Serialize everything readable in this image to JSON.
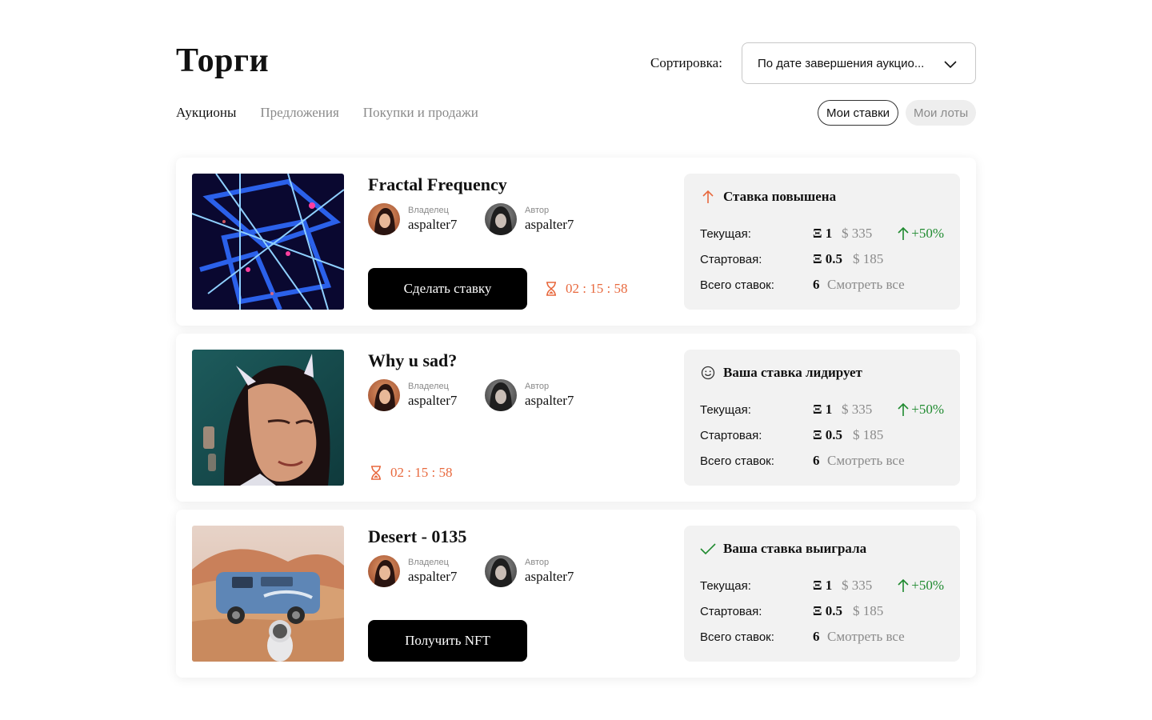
{
  "page": {
    "title": "Торги"
  },
  "sort": {
    "label": "Сортировка:",
    "value": "По дате завершения аукцио..."
  },
  "tabs": [
    {
      "label": "Аукционы",
      "active": true
    },
    {
      "label": "Предложения",
      "active": false
    },
    {
      "label": "Покупки и продажи",
      "active": false
    }
  ],
  "toggles": {
    "my_bids": "Мои ставки",
    "my_lots": "Мои лоты"
  },
  "colors": {
    "accent_orange": "#e8693e",
    "positive_green": "#1f8a2f",
    "muted": "#8a8a8a"
  },
  "common": {
    "owner_role": "Владелец",
    "author_role": "Автор",
    "current_label": "Текущая:",
    "start_label": "Стартовая:",
    "total_label": "Всего ставок:",
    "view_all": "Смотреть все"
  },
  "auctions": [
    {
      "title": "Fractal Frequency",
      "owner": "aspalter7",
      "author": "aspalter7",
      "action_label": "Сделать ставку",
      "timer": "02 : 15 : 58",
      "status": {
        "label": "Ставка повышена",
        "icon": "arrow-up-icon"
      },
      "current_eth": "Ξ 1",
      "current_usd": "$ 335",
      "change": "+50%",
      "start_eth": "Ξ 0.5",
      "start_usd": "$ 185",
      "bid_count": "6"
    },
    {
      "title": "Why u sad?",
      "owner": "aspalter7",
      "author": "aspalter7",
      "timer": "02 : 15 : 58",
      "status": {
        "label": "Ваша ставка лидирует",
        "icon": "smile-icon"
      },
      "current_eth": "Ξ 1",
      "current_usd": "$ 335",
      "change": "+50%",
      "start_eth": "Ξ 0.5",
      "start_usd": "$ 185",
      "bid_count": "6"
    },
    {
      "title": "Desert - 0135",
      "owner": "aspalter7",
      "author": "aspalter7",
      "action_label": "Получить NFT",
      "status": {
        "label": "Ваша ставка выиграла",
        "icon": "check-icon"
      },
      "current_eth": "Ξ 1",
      "current_usd": "$ 335",
      "change": "+50%",
      "start_eth": "Ξ 0.5",
      "start_usd": "$ 185",
      "bid_count": "6"
    }
  ]
}
